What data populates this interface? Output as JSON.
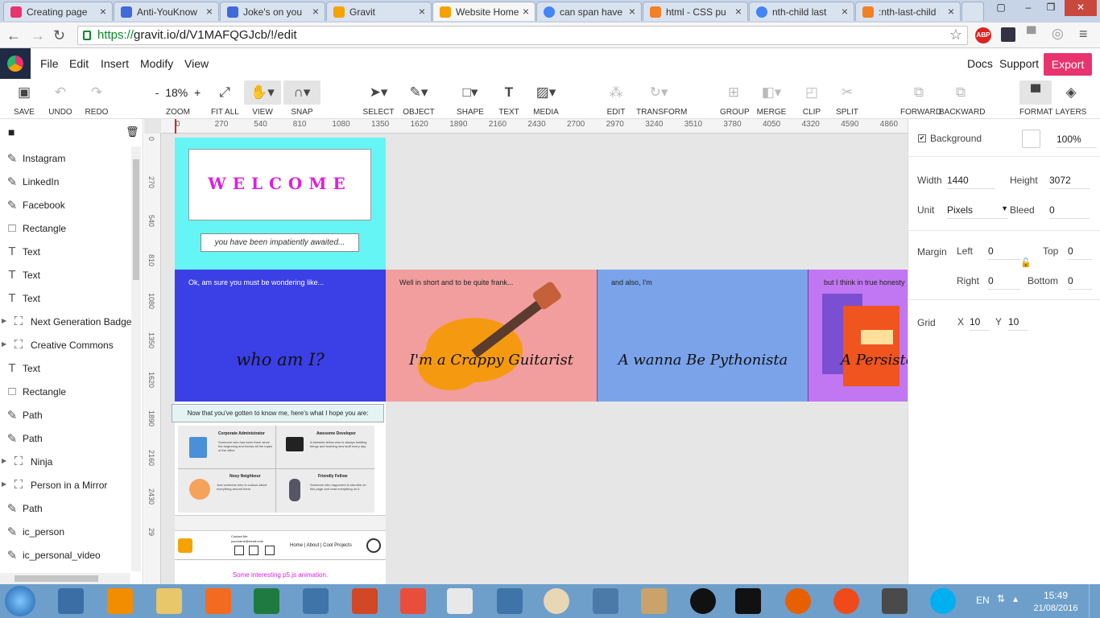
{
  "browser": {
    "tabs": [
      {
        "title": "Creating page",
        "icon_color": "#e8336e"
      },
      {
        "title": "Anti-YouKnow",
        "icon_color": "#3f6ad8"
      },
      {
        "title": "Joke's on you",
        "icon_color": "#3f6ad8"
      },
      {
        "title": "Gravit",
        "icon_color": "#f4a300"
      },
      {
        "title": "Website Home",
        "icon_color": "#f4a300"
      },
      {
        "title": "can span have",
        "icon_color": "#4285f4"
      },
      {
        "title": "html - CSS pu",
        "icon_color": "#f48024"
      },
      {
        "title": "nth-child last",
        "icon_color": "#4285f4"
      },
      {
        "title": ":nth-last-child",
        "icon_color": "#f48024"
      }
    ],
    "active_tab_index": 4,
    "url_scheme": "https://",
    "url_rest": "gravit.io/d/V1MAFQGJcb/!/edit",
    "abp_label": "ABP"
  },
  "menu": {
    "items": [
      "File",
      "Edit",
      "Insert",
      "Modify",
      "View"
    ],
    "right": [
      "Docs",
      "Support"
    ],
    "export_label": "Export"
  },
  "toolbar": {
    "zoom_value": "18%",
    "zoom_minus": "-",
    "zoom_plus": "+",
    "labels": {
      "save": "SAVE",
      "undo": "UNDO",
      "redo": "REDO",
      "zoom": "ZOOM",
      "fit_all": "FIT ALL",
      "view": "VIEW",
      "snap": "SNAP",
      "select": "SELECT",
      "object": "OBJECT",
      "shape": "SHAPE",
      "text": "TEXT",
      "media": "MEDIA",
      "edit": "EDIT",
      "transform": "TRANSFORM",
      "group": "GROUP",
      "merge": "MERGE",
      "clip": "CLIP",
      "split": "SPLIT",
      "forward": "FORWARD",
      "backward": "BACKWARD",
      "format": "FORMAT",
      "layers": "LAYERS"
    }
  },
  "layers": [
    {
      "name": "Instagram",
      "icon": "path-icon"
    },
    {
      "name": "LinkedIn",
      "icon": "path-icon"
    },
    {
      "name": "Facebook",
      "icon": "path-icon"
    },
    {
      "name": "Rectangle",
      "icon": "rectangle-icon"
    },
    {
      "name": "Text",
      "icon": "text-icon"
    },
    {
      "name": "Text",
      "icon": "text-icon"
    },
    {
      "name": "Text",
      "icon": "text-icon"
    },
    {
      "name": "Next Generation Badge",
      "icon": "group-icon"
    },
    {
      "name": "Creative Commons",
      "icon": "group-icon"
    },
    {
      "name": "Text",
      "icon": "text-icon"
    },
    {
      "name": "Rectangle",
      "icon": "rectangle-icon"
    },
    {
      "name": "Path",
      "icon": "path-icon"
    },
    {
      "name": "Path",
      "icon": "path-icon"
    },
    {
      "name": "Ninja",
      "icon": "group-icon"
    },
    {
      "name": "Person in a Mirror",
      "icon": "group-icon"
    },
    {
      "name": "Path",
      "icon": "path-icon"
    },
    {
      "name": "ic_person",
      "icon": "path-icon"
    },
    {
      "name": "ic_personal_video",
      "icon": "path-icon"
    }
  ],
  "ruler_h": [
    "0",
    "270",
    "540",
    "810",
    "1080",
    "1350",
    "1620",
    "1890",
    "2160",
    "2430",
    "2700",
    "2970",
    "3240",
    "3510",
    "3780",
    "4050",
    "4320",
    "4590",
    "4860"
  ],
  "ruler_v": [
    "0",
    "270",
    "540",
    "810",
    "1080",
    "1350",
    "1620",
    "1890",
    "2160",
    "2430",
    "29"
  ],
  "canvas": {
    "welcome": "WELCOME",
    "subtitle": "you have been impatiently awaited...",
    "panels": [
      {
        "caption": "Ok, am sure you must be wondering like...",
        "headline": "who am I?",
        "bg": "#3b3fe6"
      },
      {
        "caption": "Well in short and to be quite frank...",
        "headline": "I'm a Crappy Guitarist",
        "bg": "#f29e9e"
      },
      {
        "caption": "and also, I'm",
        "headline": "A wanna Be Pythonista",
        "bg": "#7aa3ea"
      },
      {
        "caption": "but I think in true honesty",
        "headline": "A Persiste",
        "bg": "#c277f2"
      }
    ],
    "hope_header": "Now that you've gotten to know me, here's what I hope you are:",
    "cards": [
      {
        "title": "Corporate Administrator",
        "body": "Someone who has been there since the beginning and knows all the ropes of the office"
      },
      {
        "title": "Awesome Developer",
        "body": "A fantastic fellow who is always building things and learning new stuff every day"
      },
      {
        "title": "Nosy Neighbour",
        "body": "Just someone who is curious about everything around them"
      },
      {
        "title": "Friendly Fellow",
        "body": "Someone who happened to stumble on this page and read everything on it"
      }
    ],
    "footer_links": "Home | About | Cool Projects",
    "footer_contact": "Contact Me",
    "footer_email": "yourname@email.com",
    "p5_note": "Some interesting p5.js animation."
  },
  "properties": {
    "background_label": "Background",
    "background_opacity": "100%",
    "width_label": "Width",
    "width_value": "1440",
    "height_label": "Height",
    "height_value": "3072",
    "unit_label": "Unit",
    "unit_value": "Pixels",
    "bleed_label": "Bleed",
    "bleed_value": "0",
    "margin_label": "Margin",
    "left_label": "Left",
    "left_value": "0",
    "top_label": "Top",
    "top_value": "0",
    "right_label": "Right",
    "right_value": "0",
    "bottom_label": "Bottom",
    "bottom_value": "0",
    "grid_label": "Grid",
    "grid_x_label": "X",
    "grid_x_value": "10",
    "grid_y_label": "Y",
    "grid_y_value": "10"
  },
  "taskbar": {
    "lang": "EN",
    "time": "15:49",
    "date": "21/08/2016"
  }
}
